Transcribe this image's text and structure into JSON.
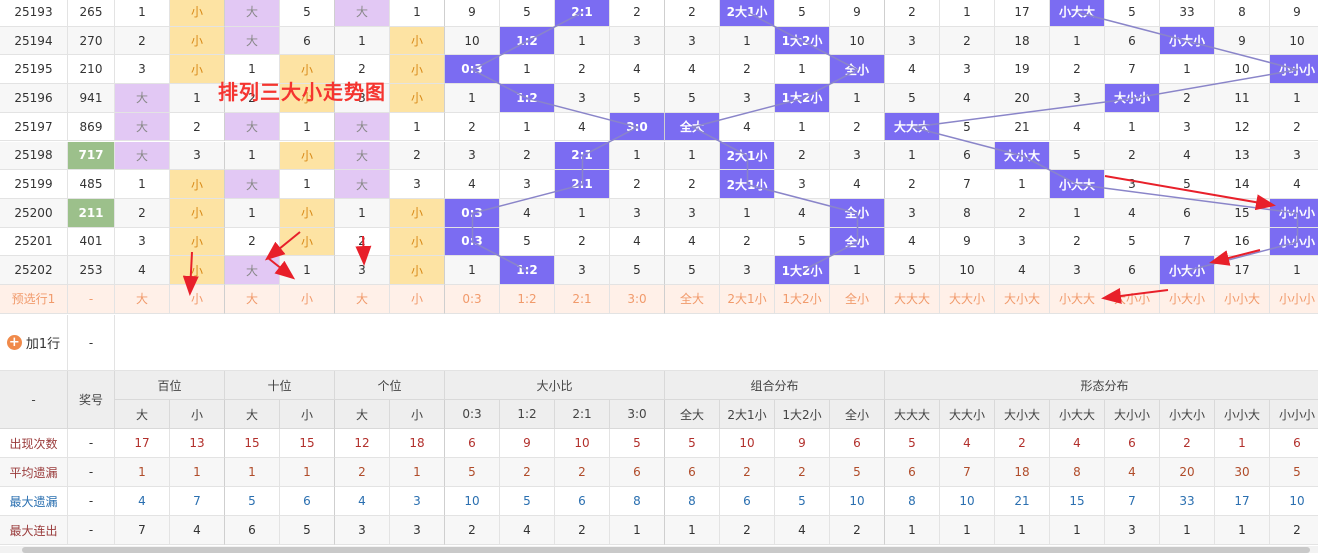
{
  "title_overlay": "排列三大小走势图",
  "rows": [
    {
      "period": "25193",
      "sum": "265",
      "sum_hl": "",
      "cells": [
        "1",
        "小",
        "大",
        "5",
        "大",
        "1",
        "9",
        "5",
        "2:1",
        "2",
        "2",
        "2大1小",
        "5",
        "9",
        "2",
        "1",
        "17",
        "小大大",
        "5",
        "33",
        "8",
        "9"
      ]
    },
    {
      "period": "25194",
      "sum": "270",
      "sum_hl": "",
      "cells": [
        "2",
        "小",
        "大",
        "6",
        "1",
        "小",
        "10",
        "1:2",
        "1",
        "3",
        "3",
        "1",
        "1大2小",
        "10",
        "3",
        "2",
        "18",
        "1",
        "6",
        "小大小",
        "9",
        "10"
      ]
    },
    {
      "period": "25195",
      "sum": "210",
      "sum_hl": "",
      "cells": [
        "3",
        "小",
        "1",
        "小",
        "2",
        "小",
        "0:3",
        "1",
        "2",
        "4",
        "4",
        "2",
        "1",
        "全小",
        "4",
        "3",
        "19",
        "2",
        "7",
        "1",
        "10",
        "小小小"
      ]
    },
    {
      "period": "25196",
      "sum": "941",
      "sum_hl": "",
      "cells": [
        "大",
        "1",
        "2",
        "小",
        "3",
        "小",
        "1",
        "1:2",
        "3",
        "5",
        "5",
        "3",
        "1大2小",
        "1",
        "5",
        "4",
        "20",
        "3",
        "大小小",
        "2",
        "11",
        "1"
      ]
    },
    {
      "period": "25197",
      "sum": "869",
      "sum_hl": "",
      "cells": [
        "大",
        "2",
        "大",
        "1",
        "大",
        "1",
        "2",
        "1",
        "4",
        "3:0",
        "全大",
        "4",
        "1",
        "2",
        "大大大",
        "5",
        "21",
        "4",
        "1",
        "3",
        "12",
        "2"
      ]
    },
    {
      "period": "25198",
      "sum": "717",
      "sum_hl": "g",
      "cells": [
        "大",
        "3",
        "1",
        "小",
        "大",
        "2",
        "3",
        "2",
        "2:1",
        "1",
        "1",
        "2大1小",
        "2",
        "3",
        "1",
        "6",
        "大小大",
        "5",
        "2",
        "4",
        "13",
        "3"
      ]
    },
    {
      "period": "25199",
      "sum": "485",
      "sum_hl": "",
      "cells": [
        "1",
        "小",
        "大",
        "1",
        "大",
        "3",
        "4",
        "3",
        "2:1",
        "2",
        "2",
        "2大1小",
        "3",
        "4",
        "2",
        "7",
        "1",
        "小大大",
        "3",
        "5",
        "14",
        "4"
      ]
    },
    {
      "period": "25200",
      "sum": "211",
      "sum_hl": "g",
      "cells": [
        "2",
        "小",
        "1",
        "小",
        "1",
        "小",
        "0:3",
        "4",
        "1",
        "3",
        "3",
        "1",
        "4",
        "全小",
        "3",
        "8",
        "2",
        "1",
        "4",
        "6",
        "15",
        "小小小"
      ]
    },
    {
      "period": "25201",
      "sum": "401",
      "sum_hl": "",
      "cells": [
        "3",
        "小",
        "2",
        "小",
        "2",
        "小",
        "0:3",
        "5",
        "2",
        "4",
        "4",
        "2",
        "5",
        "全小",
        "4",
        "9",
        "3",
        "2",
        "5",
        "7",
        "16",
        "小小小"
      ]
    },
    {
      "period": "25202",
      "sum": "253",
      "sum_hl": "",
      "cells": [
        "4",
        "小",
        "大",
        "1",
        "3",
        "小",
        "1",
        "1:2",
        "3",
        "5",
        "5",
        "3",
        "1大2小",
        "1",
        "5",
        "10",
        "4",
        "3",
        "6",
        "小大小",
        "17",
        "1"
      ]
    }
  ],
  "preselect": {
    "label": "预选行1",
    "sum": "-",
    "cells": [
      "大",
      "小",
      "大",
      "小",
      "大",
      "小",
      "0:3",
      "1:2",
      "2:1",
      "3:0",
      "全大",
      "2大1小",
      "1大2小",
      "全小",
      "大大大",
      "大大小",
      "大小大",
      "小大大",
      "大小小",
      "小大小",
      "小小大",
      "小小小"
    ]
  },
  "add_row": {
    "label": "加1行",
    "value": "-"
  },
  "header": {
    "corner": "-",
    "prize": "奖号",
    "groups": [
      "百位",
      "十位",
      "个位",
      "大小比",
      "组合分布",
      "形态分布"
    ],
    "subs": [
      "大",
      "小",
      "大",
      "小",
      "大",
      "小",
      "0:3",
      "1:2",
      "2:1",
      "3:0",
      "全大",
      "2大1小",
      "1大2小",
      "全小",
      "大大大",
      "大大小",
      "大小大",
      "小大大",
      "大小小",
      "小大小",
      "小小大",
      "小小小"
    ]
  },
  "stats": [
    {
      "label": "出现次数",
      "dash": "-",
      "tone": "red",
      "values": [
        "17",
        "13",
        "15",
        "15",
        "12",
        "18",
        "6",
        "9",
        "10",
        "5",
        "5",
        "10",
        "9",
        "6",
        "5",
        "4",
        "2",
        "4",
        "6",
        "2",
        "1",
        "6"
      ]
    },
    {
      "label": "平均遗漏",
      "dash": "-",
      "tone": "brown",
      "values": [
        "1",
        "1",
        "1",
        "1",
        "2",
        "1",
        "5",
        "2",
        "2",
        "6",
        "6",
        "2",
        "2",
        "5",
        "6",
        "7",
        "18",
        "8",
        "4",
        "20",
        "30",
        "5"
      ]
    },
    {
      "label": "最大遗漏",
      "dash": "-",
      "tone": "blue",
      "values": [
        "4",
        "7",
        "5",
        "6",
        "4",
        "3",
        "10",
        "5",
        "6",
        "8",
        "8",
        "6",
        "5",
        "10",
        "8",
        "10",
        "21",
        "15",
        "7",
        "33",
        "17",
        "10"
      ]
    },
    {
      "label": "最大连出",
      "dash": "-",
      "tone": "dark",
      "values": [
        "7",
        "4",
        "6",
        "5",
        "3",
        "3",
        "2",
        "4",
        "2",
        "1",
        "1",
        "2",
        "4",
        "2",
        "1",
        "1",
        "1",
        "1",
        "3",
        "1",
        "1",
        "2"
      ]
    }
  ],
  "colors": {
    "purple_ball": "#7b6cf2",
    "violet_bg": "#e2c8f4",
    "orange_bg": "#fde3a3",
    "green_bg": "#9cc08b",
    "arrow_red": "#e8202a",
    "trend_line": "#8a85c9"
  }
}
